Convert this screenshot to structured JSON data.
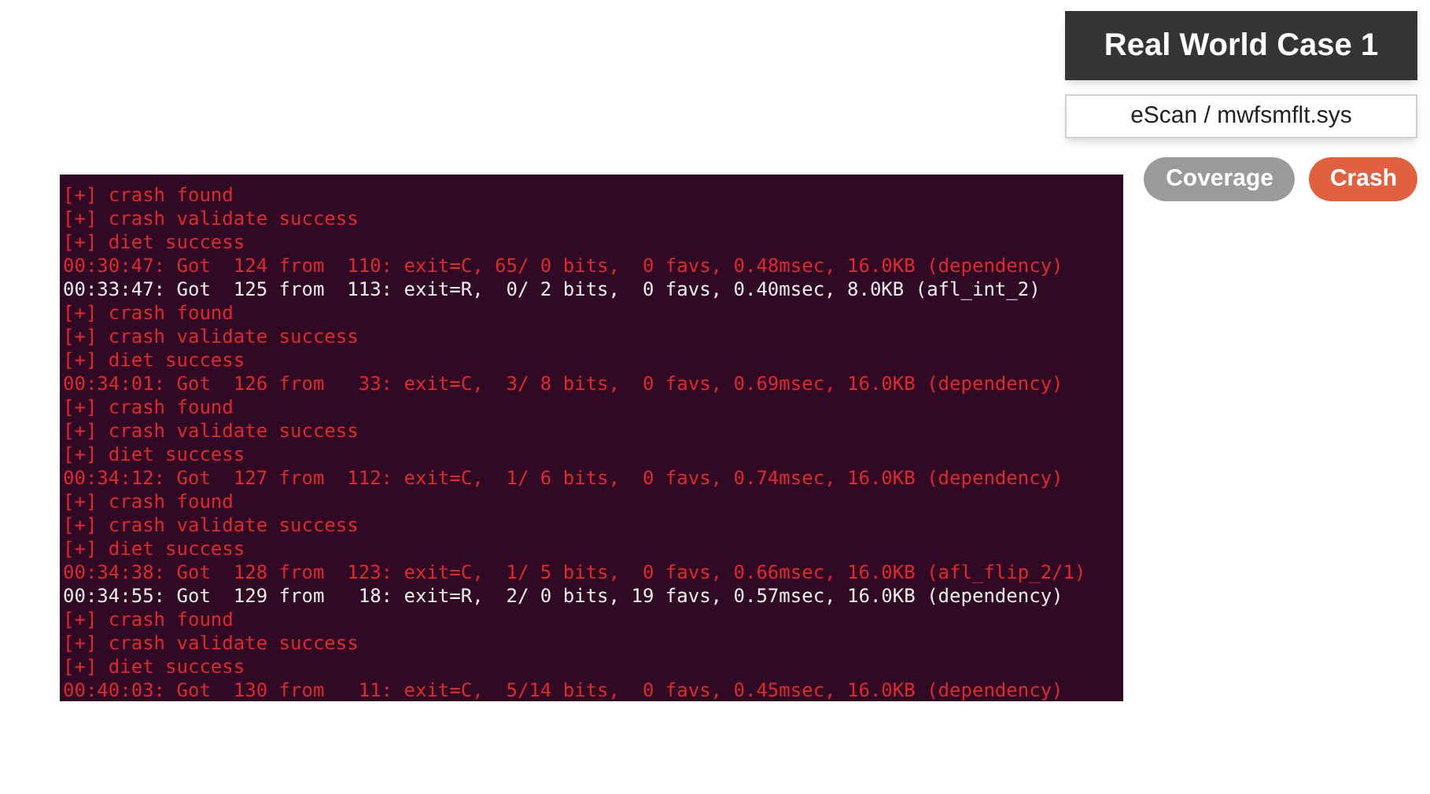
{
  "title": "Real World Case 1",
  "subtitle": "eScan / mwfsmflt.sys",
  "tabs": [
    {
      "label": "Coverage",
      "selected": false
    },
    {
      "label": "Crash",
      "selected": true
    }
  ],
  "terminal": {
    "lines": [
      {
        "kind": "crash",
        "text": "[+] crash found"
      },
      {
        "kind": "crash",
        "text": "[+] crash validate success"
      },
      {
        "kind": "crash",
        "text": "[+] diet success"
      },
      {
        "kind": "crash",
        "text": "00:30:47: Got  124 from  110: exit=C, 65/ 0 bits,  0 favs, 0.48msec, 16.0KB (dependency)"
      },
      {
        "kind": "normal",
        "text": "00:33:47: Got  125 from  113: exit=R,  0/ 2 bits,  0 favs, 0.40msec, 8.0KB (afl_int_2)"
      },
      {
        "kind": "crash",
        "text": "[+] crash found"
      },
      {
        "kind": "crash",
        "text": "[+] crash validate success"
      },
      {
        "kind": "crash",
        "text": "[+] diet success"
      },
      {
        "kind": "crash",
        "text": "00:34:01: Got  126 from   33: exit=C,  3/ 8 bits,  0 favs, 0.69msec, 16.0KB (dependency)"
      },
      {
        "kind": "crash",
        "text": "[+] crash found"
      },
      {
        "kind": "crash",
        "text": "[+] crash validate success"
      },
      {
        "kind": "crash",
        "text": "[+] diet success"
      },
      {
        "kind": "crash",
        "text": "00:34:12: Got  127 from  112: exit=C,  1/ 6 bits,  0 favs, 0.74msec, 16.0KB (dependency)"
      },
      {
        "kind": "crash",
        "text": "[+] crash found"
      },
      {
        "kind": "crash",
        "text": "[+] crash validate success"
      },
      {
        "kind": "crash",
        "text": "[+] diet success"
      },
      {
        "kind": "crash",
        "text": "00:34:38: Got  128 from  123: exit=C,  1/ 5 bits,  0 favs, 0.66msec, 16.0KB (afl_flip_2/1)"
      },
      {
        "kind": "normal",
        "text": "00:34:55: Got  129 from   18: exit=R,  2/ 0 bits, 19 favs, 0.57msec, 16.0KB (dependency)"
      },
      {
        "kind": "crash",
        "text": "[+] crash found"
      },
      {
        "kind": "crash",
        "text": "[+] crash validate success"
      },
      {
        "kind": "crash",
        "text": "[+] diet success"
      },
      {
        "kind": "crash",
        "text": "00:40:03: Got  130 from   11: exit=C,  5/14 bits,  0 favs, 0.45msec, 16.0KB (dependency)"
      }
    ]
  }
}
